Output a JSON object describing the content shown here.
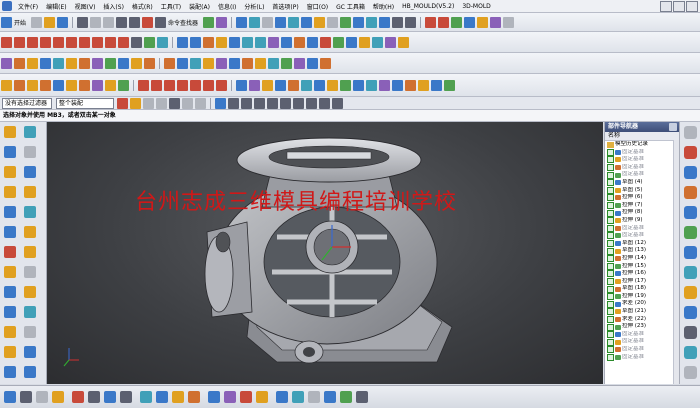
{
  "menubar": {
    "items": [
      "文件(F)",
      "编辑(E)",
      "视图(V)",
      "插入(S)",
      "格式(R)",
      "工具(T)",
      "装配(A)",
      "信息(I)",
      "分析(L)",
      "首选项(P)",
      "窗口(O)",
      "GC 工具箱",
      "帮助(H)",
      "HB_MOULD(V5.2)",
      "3D-MOLD"
    ]
  },
  "toolbar": {
    "start_label": "开始",
    "command_finder_label": "命令查找器"
  },
  "selection_bar": {
    "filter_value": "没有选择过滤器",
    "scope_value": "整个装配"
  },
  "cue_line": {
    "text": "选择对象并使用 MB3，或者双击某一对象"
  },
  "watermark": {
    "text": "台州志成三维模具编程培训学校"
  },
  "navigator": {
    "title": "部件导航器",
    "column_header": "名称",
    "root_label": "模型历史记录",
    "rows": [
      {
        "label": "固定基准"
      },
      {
        "label": "固定基准"
      },
      {
        "label": "固定基准"
      },
      {
        "label": "固定基准"
      },
      {
        "label": "草图 (4)"
      },
      {
        "label": "草图 (5)"
      },
      {
        "label": "拉伸 (6)"
      },
      {
        "label": "拉伸 (7)"
      },
      {
        "label": "拉伸 (8)"
      },
      {
        "label": "拉伸 (9)"
      },
      {
        "label": "固定基准"
      },
      {
        "label": "固定基准"
      },
      {
        "label": "草图 (12)"
      },
      {
        "label": "草图 (13)"
      },
      {
        "label": "拉伸 (14)"
      },
      {
        "label": "拉伸 (15)"
      },
      {
        "label": "拉伸 (16)"
      },
      {
        "label": "拉伸 (17)"
      },
      {
        "label": "草图 (18)"
      },
      {
        "label": "拉伸 (19)"
      },
      {
        "label": "求差 (20)"
      },
      {
        "label": "草图 (21)"
      },
      {
        "label": "求差 (22)"
      },
      {
        "label": "拉伸 (23)"
      },
      {
        "label": "固定基准"
      },
      {
        "label": "固定基准"
      },
      {
        "label": "固定基准"
      },
      {
        "label": "固定基准"
      }
    ]
  },
  "colors": {
    "viewport_center": "#5a5c60",
    "viewport_edge": "#2c2d30",
    "watermark": "#d01818",
    "navigator_header": "#3e4e78",
    "check_green": "#2a8a2a"
  },
  "icons": [
    "save-icon",
    "undo-icon",
    "redo-icon",
    "line-icon",
    "arc-icon",
    "circle-icon",
    "extrude-icon",
    "revolve-icon",
    "hole-icon",
    "blend-icon",
    "chamfer-icon",
    "measure-icon",
    "wcs-axes-icon"
  ]
}
